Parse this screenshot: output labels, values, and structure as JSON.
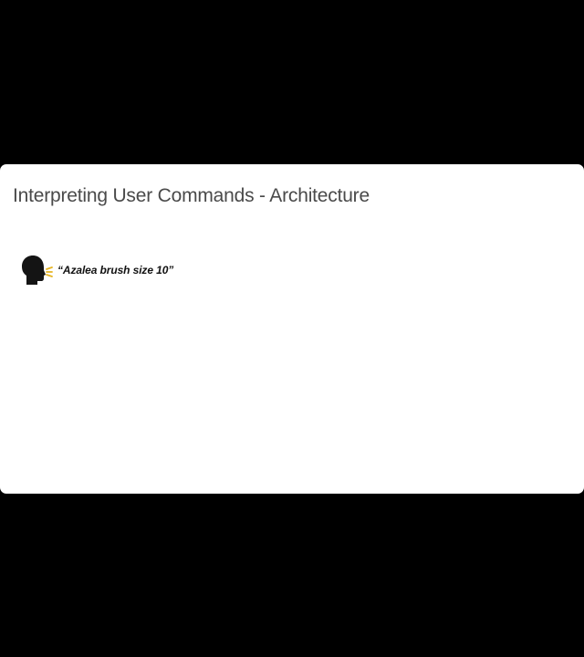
{
  "colors": {
    "background": "#000000",
    "slide": "#ffffff",
    "title_text": "#4a4a4a",
    "quote_text": "#111111",
    "speech_wave_accent": "#e6b422"
  },
  "slide": {
    "title": "Interpreting User Commands - Architecture",
    "speech": {
      "icon": "speaking-head-icon",
      "quote": "“Azalea brush size 10”"
    }
  }
}
